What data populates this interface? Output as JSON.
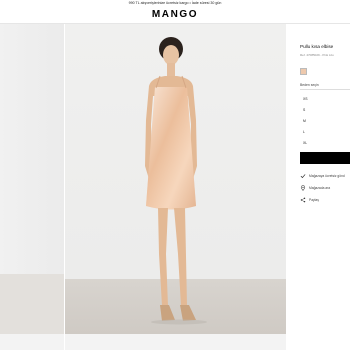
{
  "promo_bar": {
    "text": "990 TL alışverişlerinize ücretsiz kargo • İade süresi 30 gün"
  },
  "header": {
    "logo": "MANGO"
  },
  "product": {
    "title": "Pullu kısa elbise",
    "reference": "Ref. 47085029 - Pink Lilu",
    "color_swatch": "#eec9ad",
    "size_label": "Beden seçin",
    "sizes": [
      "XS",
      "S",
      "M",
      "L",
      "XL"
    ]
  },
  "actions": {
    "store_availability": "Mağazaya ücretsiz gönd",
    "find_in_store": "Mağazada ara",
    "share": "Paylaş"
  }
}
